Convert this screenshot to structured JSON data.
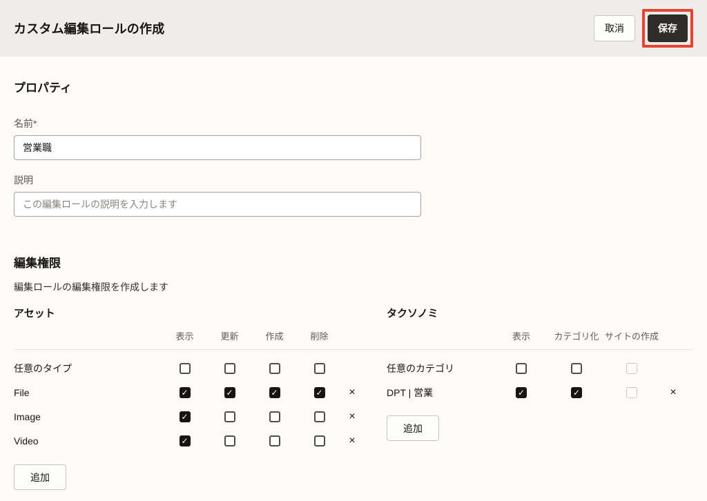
{
  "header": {
    "title": "カスタム編集ロールの作成",
    "cancel_label": "取消",
    "save_label": "保存"
  },
  "properties": {
    "heading": "プロパティ",
    "name_label": "名前*",
    "name_value": "営業職",
    "description_label": "説明",
    "description_placeholder": "この編集ロールの説明を入力します"
  },
  "permissions": {
    "heading": "編集権限",
    "subtitle": "編集ロールの編集権限を作成します",
    "tables": [
      {
        "id": "assets",
        "heading": "アセット",
        "columns": [
          "表示",
          "更新",
          "作成",
          "削除"
        ],
        "add_label": "追加",
        "rows": [
          {
            "label": "任意のタイプ",
            "checks": [
              "unchecked",
              "unchecked",
              "unchecked",
              "unchecked"
            ],
            "removable": false
          },
          {
            "label": "File",
            "checks": [
              "checked",
              "checked",
              "checked",
              "checked"
            ],
            "removable": true
          },
          {
            "label": "Image",
            "checks": [
              "checked",
              "unchecked",
              "unchecked",
              "unchecked"
            ],
            "removable": true
          },
          {
            "label": "Video",
            "checks": [
              "checked",
              "unchecked",
              "unchecked",
              "unchecked"
            ],
            "removable": true
          }
        ]
      },
      {
        "id": "taxonomies",
        "heading": "タクソノミ",
        "columns": [
          "表示",
          "カテゴリ化",
          "サイトの作成"
        ],
        "add_label": "追加",
        "rows": [
          {
            "label": "任意のカテゴリ",
            "checks": [
              "unchecked",
              "unchecked",
              "disabled"
            ],
            "removable": false
          },
          {
            "label": "DPT | 営業",
            "checks": [
              "checked",
              "checked",
              "disabled"
            ],
            "removable": true
          }
        ]
      }
    ]
  },
  "icons": {
    "checkmark": "✓",
    "remove": "×"
  },
  "colors": {
    "header_bg": "#efedeb",
    "content_bg": "#fcfbfa",
    "text_primary": "#161513",
    "save_button_bg": "#2f2c29",
    "annotation_red": "#e5452f",
    "checkbox_checked_bg": "#161513"
  }
}
